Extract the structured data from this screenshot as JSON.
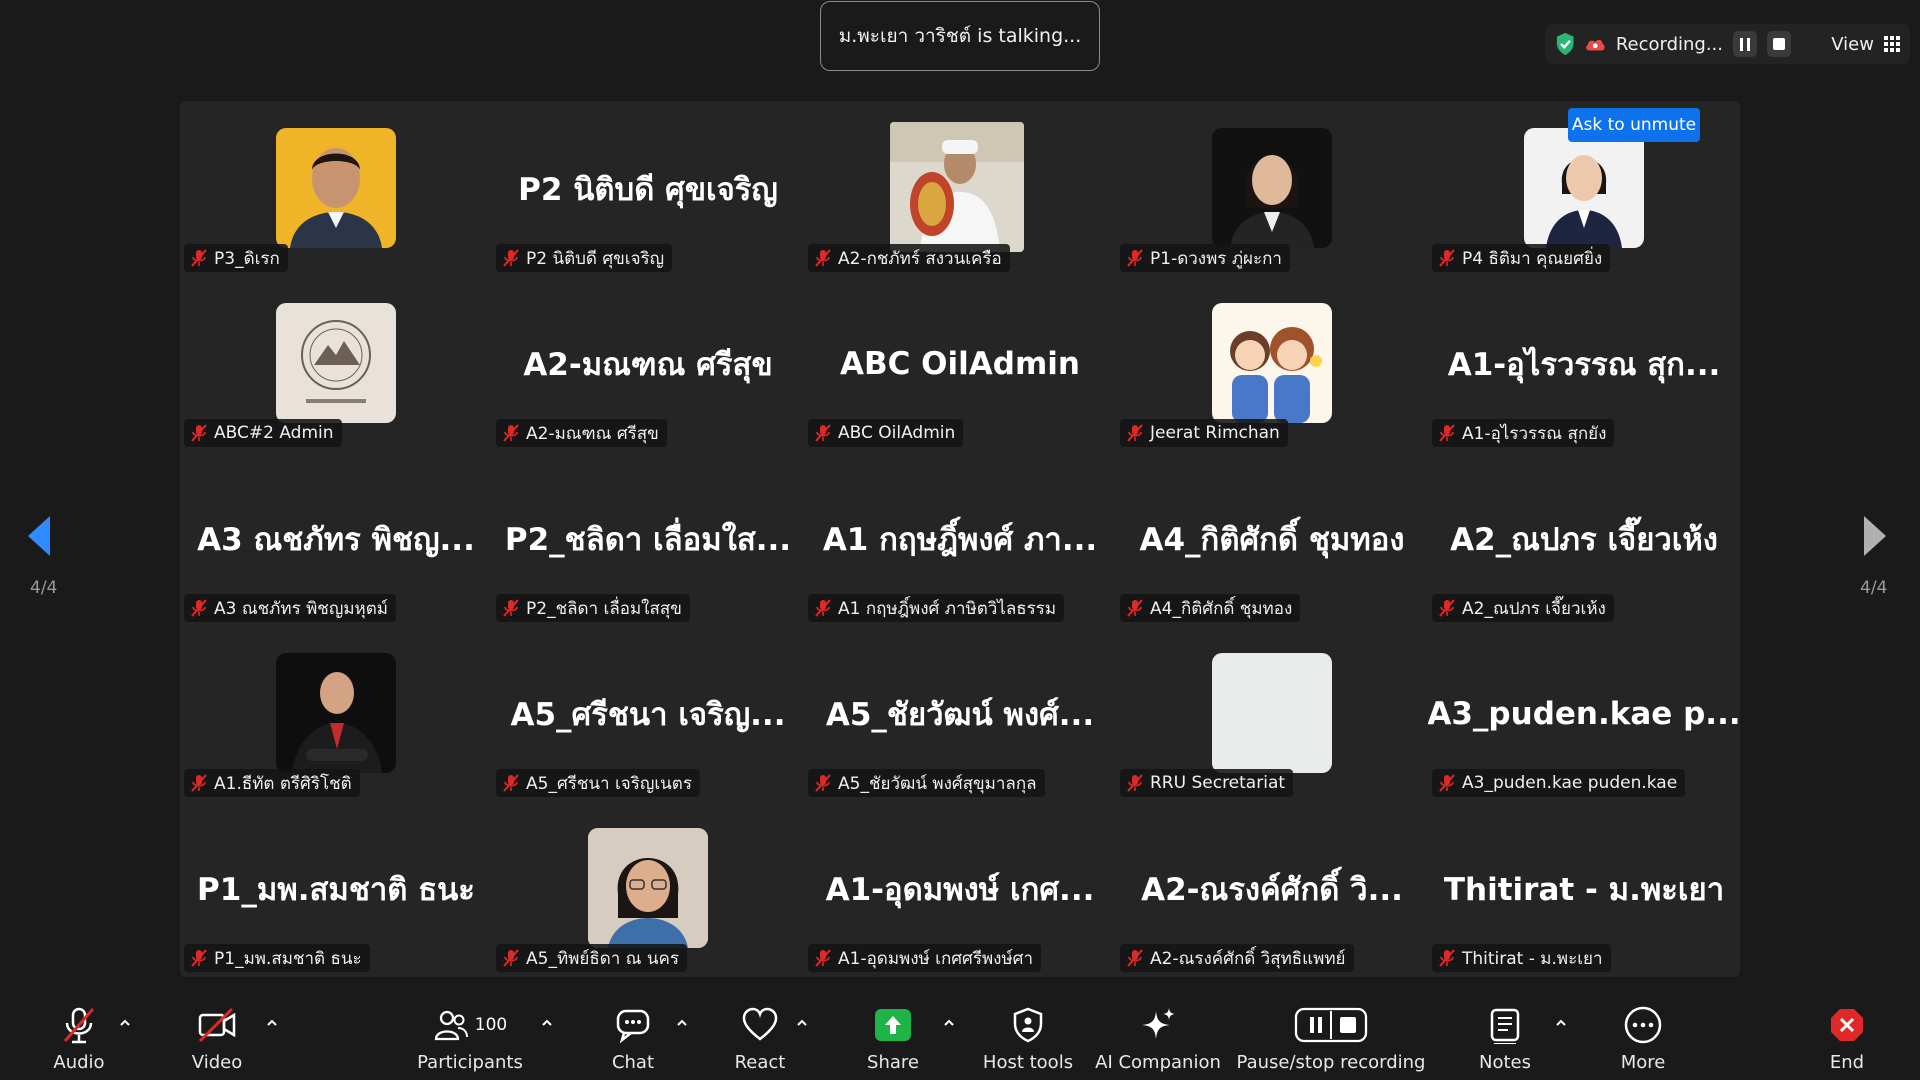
{
  "talking_banner": "ม.พะเยา วาริชต์ is talking...",
  "recording": {
    "status": "Recording...",
    "view_label": "View",
    "accent_color": "#2bb673"
  },
  "gallery": {
    "page_left": "4/4",
    "page_right": "4/4",
    "ask_to_unmute": "Ask to unmute",
    "tiles": [
      {
        "display": "",
        "label": "P3_ดิเรก"
      },
      {
        "display": "P2 นิติบดี ศุขเจริญ",
        "label": "P2 นิติบดี ศุขเจริญ"
      },
      {
        "display": "",
        "label": "A2-กชภัทร์ สงวนเครือ"
      },
      {
        "display": "",
        "label": "P1-ดวงพร ภู่ผะกา"
      },
      {
        "display": "",
        "label": "P4 ธิติมา คุณยศยิ่ง"
      },
      {
        "display": "",
        "label": "ABC#2 Admin"
      },
      {
        "display": "A2-มณฑณ ศรีสุข",
        "label": "A2-มณฑณ ศรีสุข"
      },
      {
        "display": "ABC OilAdmin",
        "label": "ABC OilAdmin"
      },
      {
        "display": "",
        "label": "Jeerat Rimchan"
      },
      {
        "display": "A1-อุไรวรรณ สุก...",
        "label": "A1-อุไรวรรณ สุกยัง"
      },
      {
        "display": "A3 ณชภัทร พิชญ...",
        "label": "A3 ณชภัทร พิชญมหุตม์"
      },
      {
        "display": "P2_ชลิดา เลื่อมใส...",
        "label": "P2_ชลิดา เลื่อมใสสุข"
      },
      {
        "display": "A1 กฤษฎิ์พงศ์ ภา...",
        "label": "A1 กฤษฎิ์พงศ์ ภาษิตวิไลธรรม"
      },
      {
        "display": "A4_กิติศักดิ์ ชุมทอง",
        "label": "A4_กิติศักดิ์ ชุมทอง"
      },
      {
        "display": "A2_ณปภร เจี๊ยวเห้ง",
        "label": "A2_ณปภร เจี๊ยวเห้ง"
      },
      {
        "display": "",
        "label": "A1.ธีทัต ตรีศิริโชติ"
      },
      {
        "display": "A5_ศรีชนา เจริญ...",
        "label": "A5_ศรีชนา เจริญเนตร"
      },
      {
        "display": "A5_ชัยวัฒน์ พงศ์...",
        "label": "A5_ชัยวัฒน์ พงศ์สุขุมาลกุล"
      },
      {
        "display": "",
        "label": "RRU Secretariat"
      },
      {
        "display": "A3_puden.kae p...",
        "label": "A3_puden.kae puden.kae"
      },
      {
        "display": "P1_มพ.สมชาติ ธนะ",
        "label": "P1_มพ.สมชาติ ธนะ"
      },
      {
        "display": "",
        "label": "A5_ทิพย์ธิดา ณ นคร"
      },
      {
        "display": "A1-อุดมพงษ์ เกศ...",
        "label": "A1-อุดมพงษ์ เกศศรีพงษ์ศา"
      },
      {
        "display": "A2-ณรงค์ศักดิ์ วิ...",
        "label": "A2-ณรงค์ศักดิ์ วิสุทธิแพทย์"
      },
      {
        "display": "Thitirat - ม.พะเยา",
        "label": "Thitirat - ม.พะเยา"
      }
    ]
  },
  "toolbar": {
    "audio": "Audio",
    "video": "Video",
    "participants": "Participants",
    "participant_count": "100",
    "chat": "Chat",
    "react": "React",
    "share": "Share",
    "host_tools": "Host tools",
    "ai_companion": "AI Companion",
    "pause_stop_recording": "Pause/stop recording",
    "notes": "Notes",
    "more": "More",
    "end": "End"
  }
}
